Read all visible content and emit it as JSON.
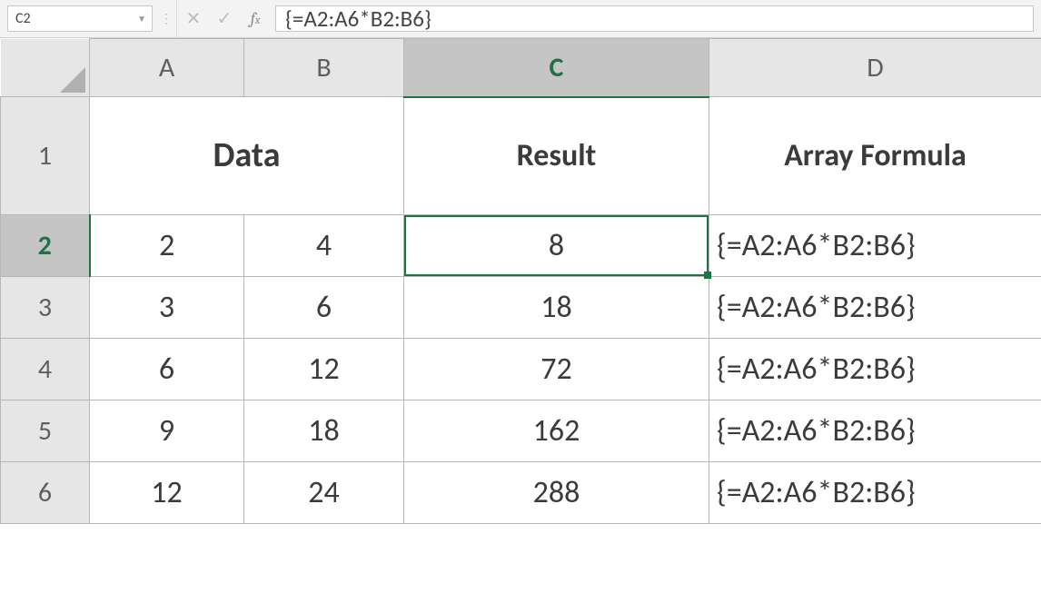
{
  "namebox": {
    "value": "C2"
  },
  "formula_bar": {
    "formula": "{=A2:A6*B2:B6}"
  },
  "columns": [
    "A",
    "B",
    "C",
    "D"
  ],
  "selected_cell": "C2",
  "header_row": {
    "data_label": "Data",
    "result_label": "Result",
    "array_formula_label": "Array Formula"
  },
  "rows": [
    {
      "n": "1"
    },
    {
      "n": "2",
      "a": "2",
      "b": "4",
      "c": "8",
      "d": "{=A2:A6*B2:B6}"
    },
    {
      "n": "3",
      "a": "3",
      "b": "6",
      "c": "18",
      "d": "{=A2:A6*B2:B6}"
    },
    {
      "n": "4",
      "a": "6",
      "b": "12",
      "c": "72",
      "d": "{=A2:A6*B2:B6}"
    },
    {
      "n": "5",
      "a": "9",
      "b": "18",
      "c": "162",
      "d": "{=A2:A6*B2:B6}"
    },
    {
      "n": "6",
      "a": "12",
      "b": "24",
      "c": "288",
      "d": "{=A2:A6*B2:B6}"
    }
  ]
}
